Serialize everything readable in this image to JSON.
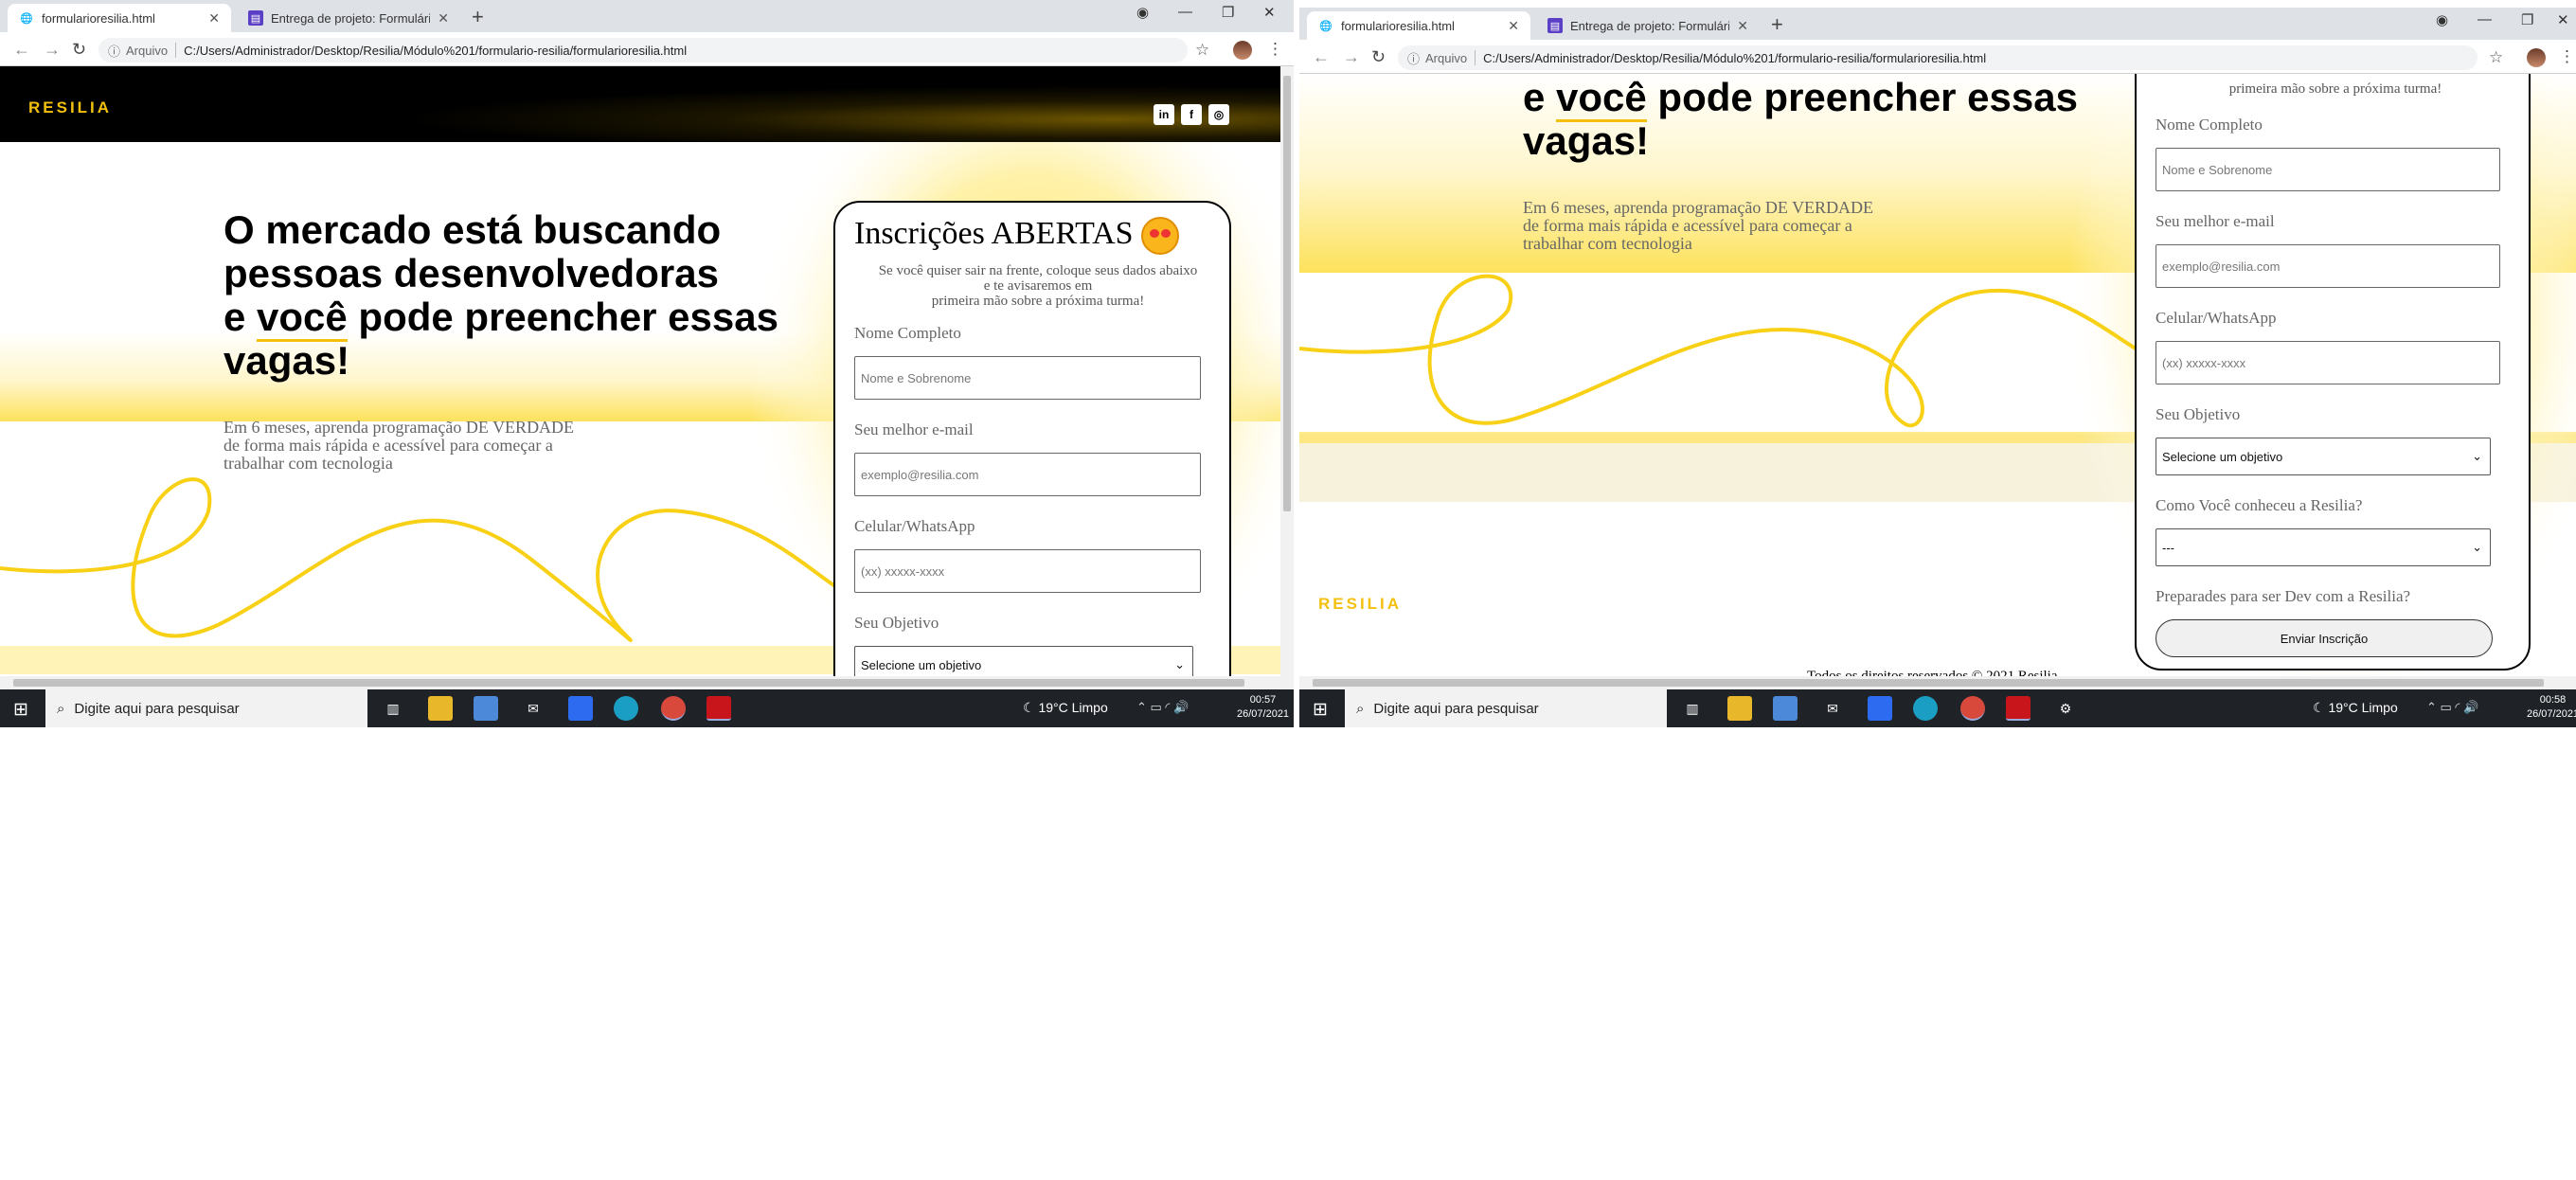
{
  "left_window": {
    "tabs": [
      {
        "label": "formularioresilia.html",
        "active": true
      },
      {
        "label": "Entrega de projeto: Formulário R",
        "active": false
      }
    ],
    "address": {
      "security": "Arquivo",
      "url": "C:/Users/Administrador/Desktop/Resilia/Módulo%201/formulario-resilia/formularioresilia.html"
    },
    "page": {
      "logo": "RESILIA",
      "socials": [
        "in",
        "f",
        "◎"
      ],
      "hero_lines": [
        "O mercado está buscando",
        "pessoas desenvolvedoras",
        "e ",
        "você",
        " pode preencher essas",
        "vagas!"
      ],
      "subtitle_lines": [
        "Em 6 meses, aprenda programação DE VERDADE",
        "de forma mais rápida e acessível para começar a",
        "trabalhar com tecnologia"
      ],
      "form": {
        "title": "Inscrições ABERTAS",
        "desc_lines": [
          "Se você quiser sair na frente, coloque seus dados abaixo",
          "e te avisaremos em",
          "primeira mão sobre a próxima turma!"
        ],
        "name_label": "Nome Completo",
        "name_placeholder": "Nome e Sobrenome",
        "email_label": "Seu melhor e-mail",
        "email_placeholder": "exemplo@resilia.com",
        "phone_label": "Celular/WhatsApp",
        "phone_placeholder": "(xx) xxxxx-xxxx",
        "goal_label": "Seu Objetivo",
        "goal_value": "Selecione um objetivo"
      }
    },
    "taskbar": {
      "search": "Digite aqui para pesquisar",
      "weather": "19°C  Limpo",
      "time": "00:57",
      "date": "26/07/2021"
    }
  },
  "right_window": {
    "tabs": [
      {
        "label": "formularioresilia.html",
        "active": true
      },
      {
        "label": "Entrega de projeto: Formulário R",
        "active": false
      }
    ],
    "address": {
      "security": "Arquivo",
      "url": "C:/Users/Administrador/Desktop/Resilia/Módulo%201/formulario-resilia/formularioresilia.html"
    },
    "page": {
      "logo": "RESILIA",
      "hero_lines": [
        "e ",
        "você",
        " pode preencher essas",
        "vagas!"
      ],
      "subtitle_lines": [
        "Em 6 meses, aprenda programação DE VERDADE",
        "de forma mais rápida e acessível para começar a",
        "trabalhar com tecnologia"
      ],
      "form": {
        "desc_tail": "primeira mão sobre a próxima turma!",
        "name_label": "Nome Completo",
        "name_placeholder": "Nome e Sobrenome",
        "email_label": "Seu melhor e-mail",
        "email_placeholder": "exemplo@resilia.com",
        "phone_label": "Celular/WhatsApp",
        "phone_placeholder": "(xx) xxxxx-xxxx",
        "goal_label": "Seu Objetivo",
        "goal_value": "Selecione um objetivo",
        "source_label": "Como Você conheceu a Resilia?",
        "source_value": "---",
        "ready_label": "Preparades para ser Dev com a Resilia?",
        "submit": "Enviar Inscrição"
      },
      "footer": "Todos os direitos reservados © 2021 Resilia"
    },
    "taskbar": {
      "search": "Digite aqui para pesquisar",
      "weather": "19°C  Limpo",
      "time": "00:58",
      "date": "26/07/2021"
    }
  },
  "colors": {
    "brand_yellow": "#f3c10d",
    "header_black": "#000000",
    "taskbar": "#1f2328"
  }
}
